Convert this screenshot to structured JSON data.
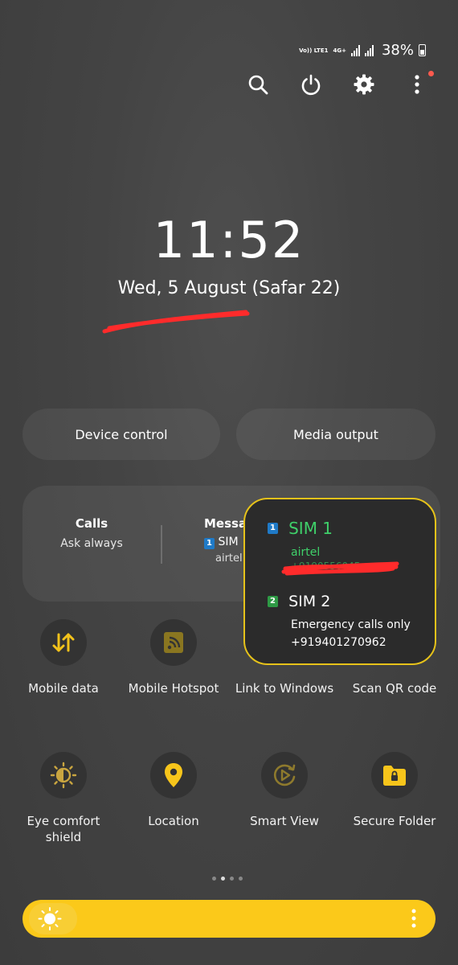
{
  "status_bar": {
    "network_1": "Vo)) LTE1",
    "network_2": "4G+",
    "battery_percent": "38%"
  },
  "quick_icons": [
    "search-icon",
    "power-icon",
    "settings-icon",
    "more-icon"
  ],
  "lock": {
    "time": "11:52",
    "date": "Wed, 5 August (Safar 22)"
  },
  "buttons": {
    "device_control": "Device control",
    "media_output": "Media output"
  },
  "sim_panel": {
    "calls_label": "Calls",
    "calls_value": "Ask always",
    "messages_label": "Messag",
    "messages_sim": "SIM",
    "messages_carrier": "airtel",
    "badge_1": "1"
  },
  "sim_popup": {
    "sim1": {
      "badge": "1",
      "name": "SIM 1",
      "carrier": "airtel",
      "number_redacted": "+9190556045"
    },
    "sim2": {
      "badge": "2",
      "name": "SIM 2",
      "status": "Emergency calls only",
      "number": "+919401270962"
    }
  },
  "tiles_row1": [
    {
      "label": "Mobile data",
      "icon": "mobile-data-icon"
    },
    {
      "label": "Mobile Hotspot",
      "icon": "hotspot-icon"
    },
    {
      "label": "Link to Windows",
      "icon": "link-windows-icon"
    },
    {
      "label": "Scan QR code",
      "icon": "qr-icon"
    }
  ],
  "tiles_row2": [
    {
      "label": "Eye comfort shield",
      "icon": "eye-comfort-icon"
    },
    {
      "label": "Location",
      "icon": "location-icon"
    },
    {
      "label": "Smart View",
      "icon": "smart-view-icon"
    },
    {
      "label": "Secure Folder",
      "icon": "secure-folder-icon"
    }
  ],
  "page_indicator": {
    "count": 4,
    "active": 1
  },
  "colors": {
    "accent": "#fbc91a",
    "sim1_green": "#3fd06a",
    "red_mark": "#ff2b2b",
    "popup_border": "#e6c21a"
  }
}
